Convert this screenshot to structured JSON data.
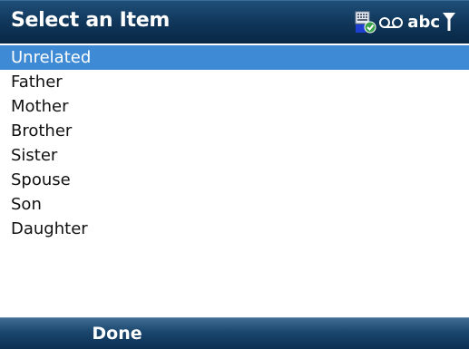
{
  "header": {
    "title": "Select an Item",
    "input_mode": "abc"
  },
  "list": {
    "selected_index": 0,
    "items": [
      "Unrelated",
      "Father",
      "Mother",
      "Brother",
      "Sister",
      "Spouse",
      "Son",
      "Daughter"
    ]
  },
  "softkeys": {
    "left_label": "Done"
  },
  "colors": {
    "title_bar": "#0f3558",
    "selection": "#3e8ad4",
    "softkey_bar": "#1a466e"
  },
  "icons": {
    "status": [
      "keyboard-icon",
      "voicemail-icon",
      "signal-icon"
    ]
  }
}
